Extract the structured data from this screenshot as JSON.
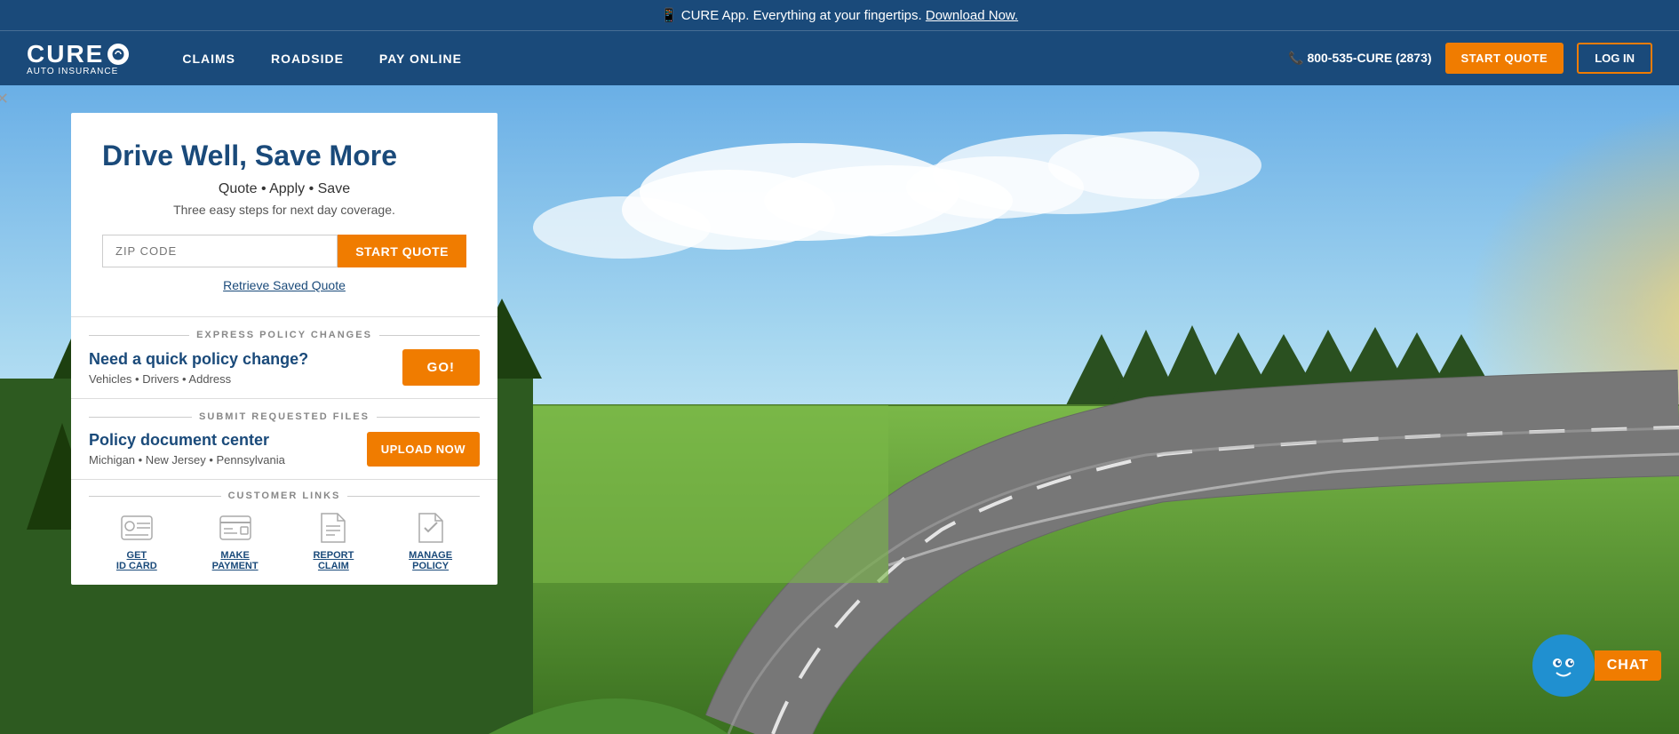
{
  "banner": {
    "icon": "📱",
    "text": "CURE App. Everything at your fingertips.",
    "link_text": "Download Now."
  },
  "nav": {
    "logo": {
      "name": "CURE",
      "sub": "AUTO INSURANCE"
    },
    "links": [
      {
        "label": "CLAIMS",
        "href": "#"
      },
      {
        "label": "ROADSIDE",
        "href": "#"
      },
      {
        "label": "PAY ONLINE",
        "href": "#"
      }
    ],
    "phone": "📞 800-535-CURE (2873)",
    "start_quote_label": "START QUOTE",
    "login_label": "LOG IN"
  },
  "hero": {
    "quote_section": {
      "title": "Drive Well, Save More",
      "subtitle": "Quote • Apply • Save",
      "description": "Three easy steps for next day coverage.",
      "zip_placeholder": "ZIP CODE",
      "start_btn": "START QUOTE",
      "retrieve_link": "Retrieve Saved Quote"
    },
    "express_policy": {
      "section_label": "EXPRESS POLICY CHANGES",
      "heading": "Need a quick policy change?",
      "detail": "Vehicles • Drivers • Address",
      "btn": "GO!"
    },
    "submit_files": {
      "section_label": "SUBMIT REQUESTED FILES",
      "heading": "Policy document center",
      "detail": "Michigan • New Jersey • Pennsylvania",
      "btn": "UPLOAD NOW"
    },
    "customer_links": {
      "section_label": "CUSTOMER LINKS",
      "items": [
        {
          "icon": "🪪",
          "label": "GET\nID CARD"
        },
        {
          "icon": "💳",
          "label": "MAKE\nPAYMENT"
        },
        {
          "icon": "📋",
          "label": "REPORT\nCLAIM"
        },
        {
          "icon": "📄",
          "label": "MANAGE\nPOLICY"
        }
      ]
    }
  },
  "chat": {
    "avatar": "😊",
    "label": "CHAT"
  }
}
